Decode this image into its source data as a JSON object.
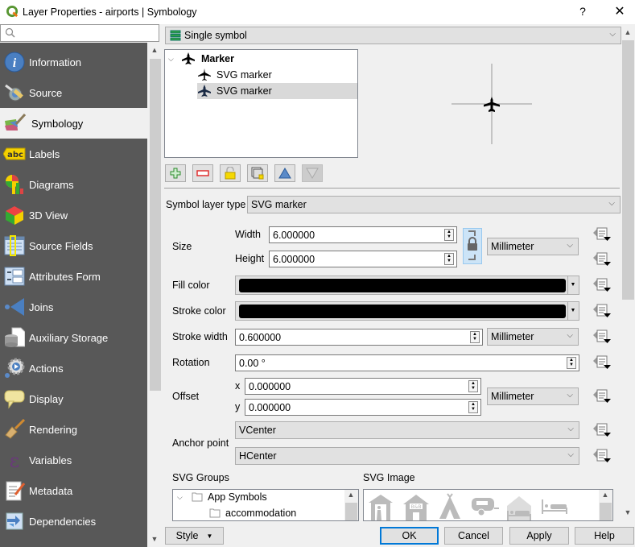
{
  "window": {
    "title": "Layer Properties - airports | Symbology",
    "help_label": "?",
    "close_label": "✕"
  },
  "sidebar": {
    "search_placeholder": "",
    "items": [
      {
        "label": "Information",
        "icon": "info-icon"
      },
      {
        "label": "Source",
        "icon": "source-icon"
      },
      {
        "label": "Symbology",
        "icon": "symbology-icon",
        "active": true
      },
      {
        "label": "Labels",
        "icon": "labels-icon"
      },
      {
        "label": "Diagrams",
        "icon": "diagrams-icon"
      },
      {
        "label": "3D View",
        "icon": "3d-view-icon"
      },
      {
        "label": "Source Fields",
        "icon": "source-fields-icon"
      },
      {
        "label": "Attributes Form",
        "icon": "attributes-form-icon"
      },
      {
        "label": "Joins",
        "icon": "joins-icon"
      },
      {
        "label": "Auxiliary Storage",
        "icon": "auxiliary-storage-icon"
      },
      {
        "label": "Actions",
        "icon": "actions-icon"
      },
      {
        "label": "Display",
        "icon": "display-icon"
      },
      {
        "label": "Rendering",
        "icon": "rendering-icon"
      },
      {
        "label": "Variables",
        "icon": "variables-icon"
      },
      {
        "label": "Metadata",
        "icon": "metadata-icon"
      },
      {
        "label": "Dependencies",
        "icon": "dependencies-icon"
      }
    ]
  },
  "renderer": {
    "selected": "Single symbol"
  },
  "symbol_tree": {
    "root": "Marker",
    "layers": [
      "SVG marker",
      "SVG marker"
    ],
    "selected_index": 1
  },
  "toolbar": {
    "add": "add-symbol-layer",
    "remove": "remove-symbol-layer",
    "lock": "lock-layer-color",
    "duplicate": "duplicate-layer",
    "up": "move-up",
    "down": "move-down"
  },
  "form": {
    "symbol_layer_type_label": "Symbol layer type",
    "symbol_layer_type": "SVG marker",
    "size_label": "Size",
    "width_label": "Width",
    "width_value": "6.000000",
    "height_label": "Height",
    "height_value": "6.000000",
    "size_unit": "Millimeter",
    "fill_color_label": "Fill color",
    "fill_color": "#000000",
    "stroke_color_label": "Stroke color",
    "stroke_color": "#000000",
    "stroke_width_label": "Stroke width",
    "stroke_width_value": "0.600000",
    "stroke_width_unit": "Millimeter",
    "rotation_label": "Rotation",
    "rotation_value": "0.00 °",
    "offset_label": "Offset",
    "offset_x_label": "x",
    "offset_x_value": "0.000000",
    "offset_y_label": "y",
    "offset_y_value": "0.000000",
    "offset_unit": "Millimeter",
    "anchor_label": "Anchor point",
    "anchor_v": "VCenter",
    "anchor_h": "HCenter"
  },
  "svg_browser": {
    "groups_label": "SVG Groups",
    "images_label": "SVG Image",
    "groups": [
      {
        "label": "App Symbols",
        "expanded": true
      },
      {
        "label": "accommodation"
      }
    ],
    "images": [
      "alpine-hut",
      "bed-and-breakfast",
      "camping",
      "caravan-park",
      "chalet",
      "hotel"
    ]
  },
  "buttons": {
    "style": "Style",
    "ok": "OK",
    "cancel": "Cancel",
    "apply": "Apply",
    "help": "Help"
  }
}
